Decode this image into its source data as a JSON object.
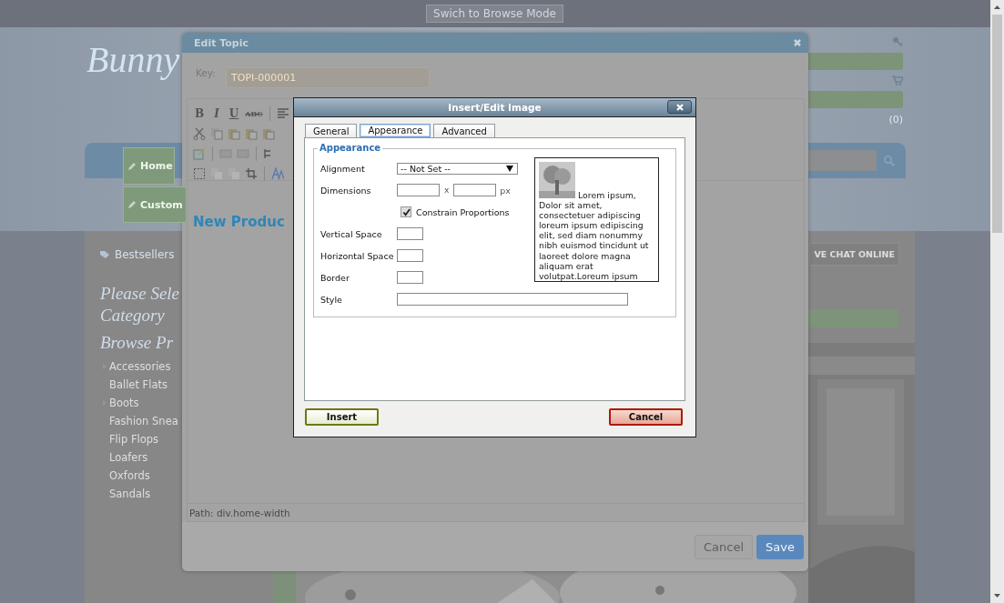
{
  "top_bar": {
    "browse_mode_button": "Swich to Browse Mode"
  },
  "site": {
    "logo": "Bunny",
    "cart_count": "(0)",
    "nav_tabs": [
      {
        "label": "Home"
      },
      {
        "label": "Custom"
      }
    ],
    "content_tab": "Bestsellers",
    "live_chat": "VE CHAT ONLINE",
    "sidebar_headings": [
      "Please Sele",
      "Category",
      "Browse Pr"
    ],
    "categories": [
      {
        "label": "Accessories",
        "expandable": true
      },
      {
        "label": "Ballet Flats",
        "expandable": false
      },
      {
        "label": "Boots",
        "expandable": true
      },
      {
        "label": "Fashion Snea",
        "expandable": false
      },
      {
        "label": "Flip Flops",
        "expandable": false
      },
      {
        "label": "Loafers",
        "expandable": false
      },
      {
        "label": "Oxfords",
        "expandable": false
      },
      {
        "label": "Sandals",
        "expandable": false
      }
    ]
  },
  "edit_topic": {
    "title": "Edit Topic",
    "key_label": "Key:",
    "key_value": "TOPI-000001",
    "format_buttons": [
      {
        "label": "B",
        "kind": "bold"
      },
      {
        "label": "I",
        "kind": "italic"
      },
      {
        "label": "U",
        "kind": "underline"
      },
      {
        "label": "ABC",
        "kind": "strike"
      }
    ],
    "editor_heading": "New Produc",
    "path": "Path: div.home-width",
    "buttons": [
      {
        "label": "Cancel",
        "kind": "secondary"
      },
      {
        "label": "Save",
        "kind": "primary"
      }
    ]
  },
  "image_dialog": {
    "title": "Insert/Edit Image",
    "tabs": [
      {
        "label": "General",
        "selected": false
      },
      {
        "label": "Appearance",
        "selected": true
      },
      {
        "label": "Advanced",
        "selected": false
      }
    ],
    "legend": "Appearance",
    "fields": [
      {
        "kind": "select",
        "label": "Alignment",
        "value": "-- Not Set --"
      },
      {
        "kind": "dimensions",
        "label": "Dimensions",
        "separator": "x",
        "unit": "px"
      },
      {
        "kind": "checkbox",
        "label": "Constrain Proportions",
        "checked": true
      },
      {
        "kind": "small",
        "label": "Vertical Space"
      },
      {
        "kind": "small",
        "label": "Horizontal Space"
      },
      {
        "kind": "small",
        "label": "Border"
      },
      {
        "kind": "wide",
        "label": "Style"
      }
    ],
    "preview_text": "Lorem ipsum, Dolor sit amet, consectetuer adipiscing loreum ipsum edipiscing elit, sed diam nonummy nibh euismod tincidunt ut laoreet dolore magna aliquam erat volutpat.Loreum ipsum",
    "buttons": [
      {
        "label": "Insert",
        "kind": "insert"
      },
      {
        "label": "Cancel",
        "kind": "cancel"
      }
    ]
  }
}
